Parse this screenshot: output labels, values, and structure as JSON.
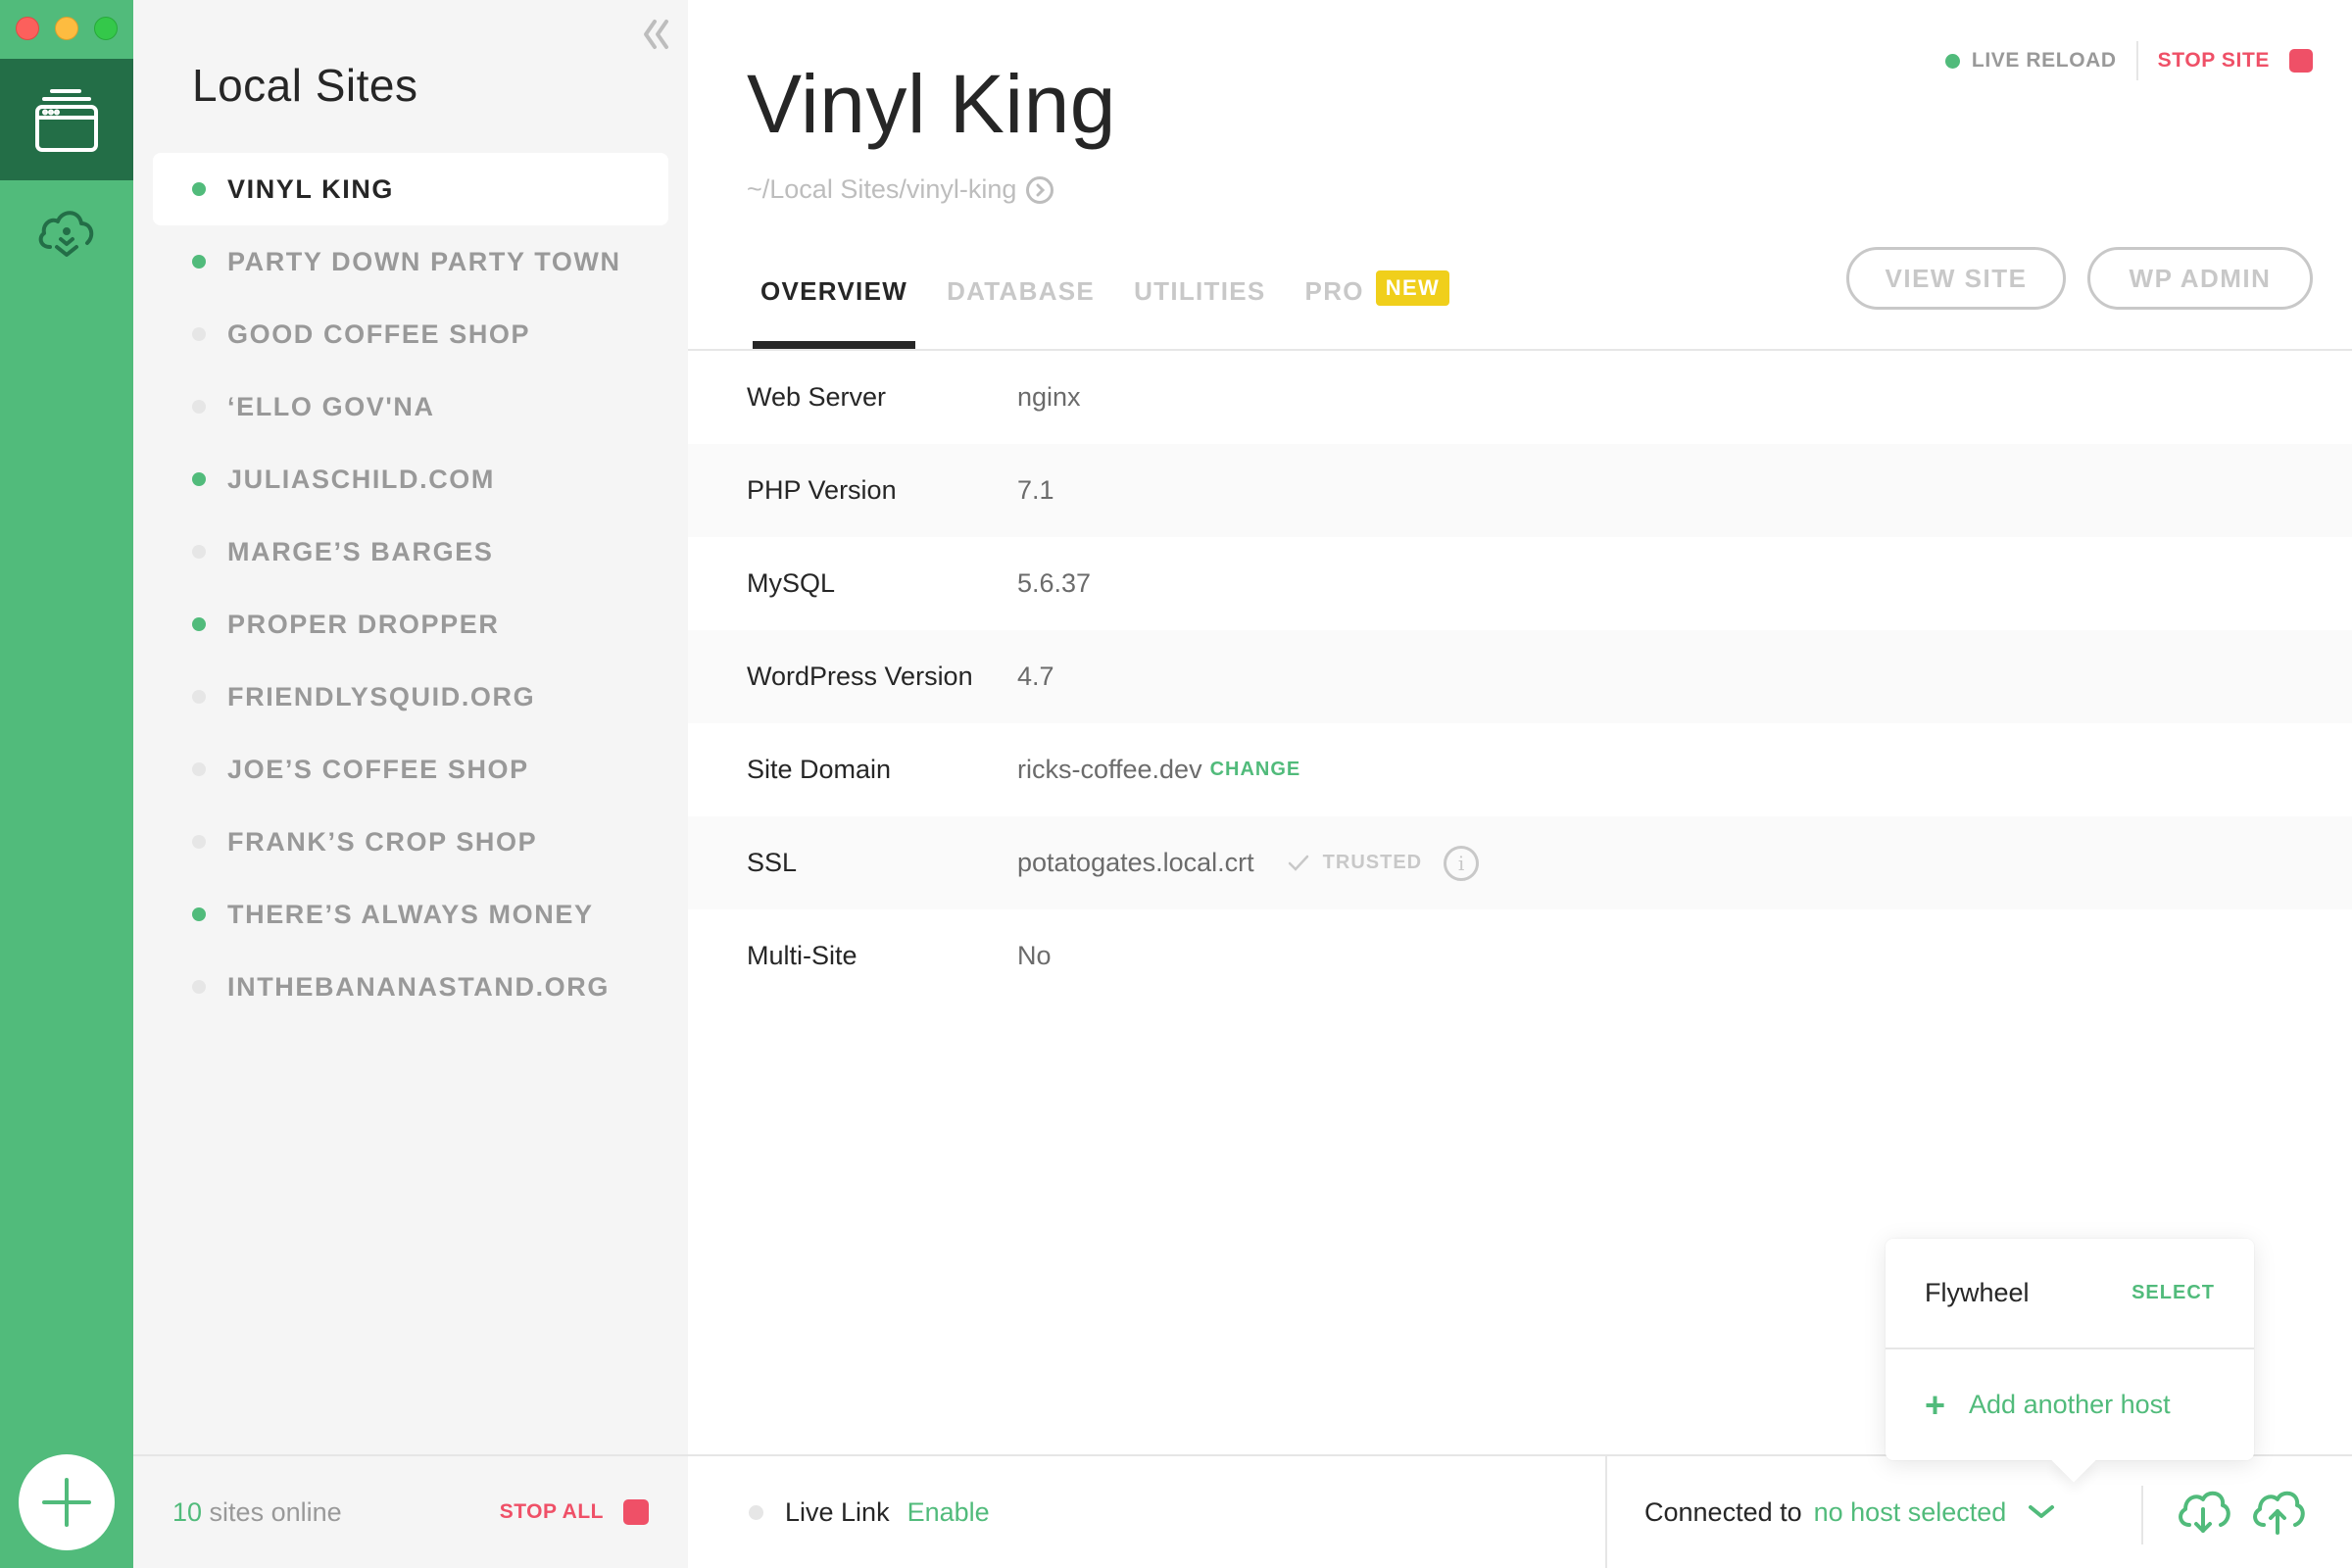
{
  "window": {
    "controls": [
      "close",
      "minimize",
      "maximize"
    ]
  },
  "rail": {
    "items": [
      {
        "name": "local-sites",
        "icon": "browser-window-stack-icon",
        "active": true
      },
      {
        "name": "connect",
        "icon": "cloud-download-icon",
        "active": false
      }
    ],
    "add_button_icon": "plus-icon"
  },
  "sidebar": {
    "title": "Local Sites",
    "collapse_icon": "double-chevron-left-icon",
    "sites": [
      {
        "name": "VINYL KING",
        "running": true,
        "active": true
      },
      {
        "name": "PARTY DOWN PARTY TOWN",
        "running": true,
        "active": false
      },
      {
        "name": "GOOD COFFEE SHOP",
        "running": false,
        "active": false
      },
      {
        "name": "‘ELLO GOV'NA",
        "running": false,
        "active": false
      },
      {
        "name": "JULIASCHILD.COM",
        "running": true,
        "active": false
      },
      {
        "name": "MARGE’S BARGES",
        "running": false,
        "active": false
      },
      {
        "name": "PROPER DROPPER",
        "running": true,
        "active": false
      },
      {
        "name": "FRIENDLYSQUID.ORG",
        "running": false,
        "active": false
      },
      {
        "name": "JOE’S COFFEE SHOP",
        "running": false,
        "active": false
      },
      {
        "name": "FRANK’S CROP SHOP",
        "running": false,
        "active": false
      },
      {
        "name": "THERE’S ALWAYS MONEY",
        "running": true,
        "active": false
      },
      {
        "name": "INTHEBANANASTAND.ORG",
        "running": false,
        "active": false
      }
    ],
    "footer": {
      "online_count": "10",
      "online_label": " sites online",
      "stop_all_label": "STOP ALL"
    }
  },
  "site": {
    "title": "Vinyl King",
    "path": "~/Local Sites/vinyl-king",
    "live_reload_label": "LIVE RELOAD",
    "stop_site_label": "STOP SITE",
    "view_site_label": "VIEW SITE",
    "wp_admin_label": "WP ADMIN"
  },
  "tabs": [
    {
      "label": "OVERVIEW",
      "active": true
    },
    {
      "label": "DATABASE",
      "active": false
    },
    {
      "label": "UTILITIES",
      "active": false
    },
    {
      "label": "PRO",
      "active": false,
      "badge": "NEW"
    }
  ],
  "overview": {
    "rows": [
      {
        "label": "Web Server",
        "value": "nginx"
      },
      {
        "label": "PHP Version",
        "value": "7.1"
      },
      {
        "label": "MySQL",
        "value": "5.6.37"
      },
      {
        "label": "WordPress Version",
        "value": "4.7"
      },
      {
        "label": "Site Domain",
        "value": "ricks-coffee.dev",
        "action": "CHANGE"
      },
      {
        "label": "SSL",
        "value": "potatogates.local.crt",
        "status": "TRUSTED"
      },
      {
        "label": "Multi-Site",
        "value": "No"
      }
    ]
  },
  "footer": {
    "live_link_label": "Live Link",
    "live_link_action": "Enable",
    "connected_label": "Connected to",
    "host_value": "no host selected"
  },
  "host_popover": {
    "provider": "Flywheel",
    "select_label": "SELECT",
    "add_host_label": "Add another host"
  },
  "colors": {
    "brand_green": "#51bb7b",
    "dark_green": "#236e47",
    "stop_red": "#ef5067",
    "badge_yellow": "#f0cf1b"
  }
}
